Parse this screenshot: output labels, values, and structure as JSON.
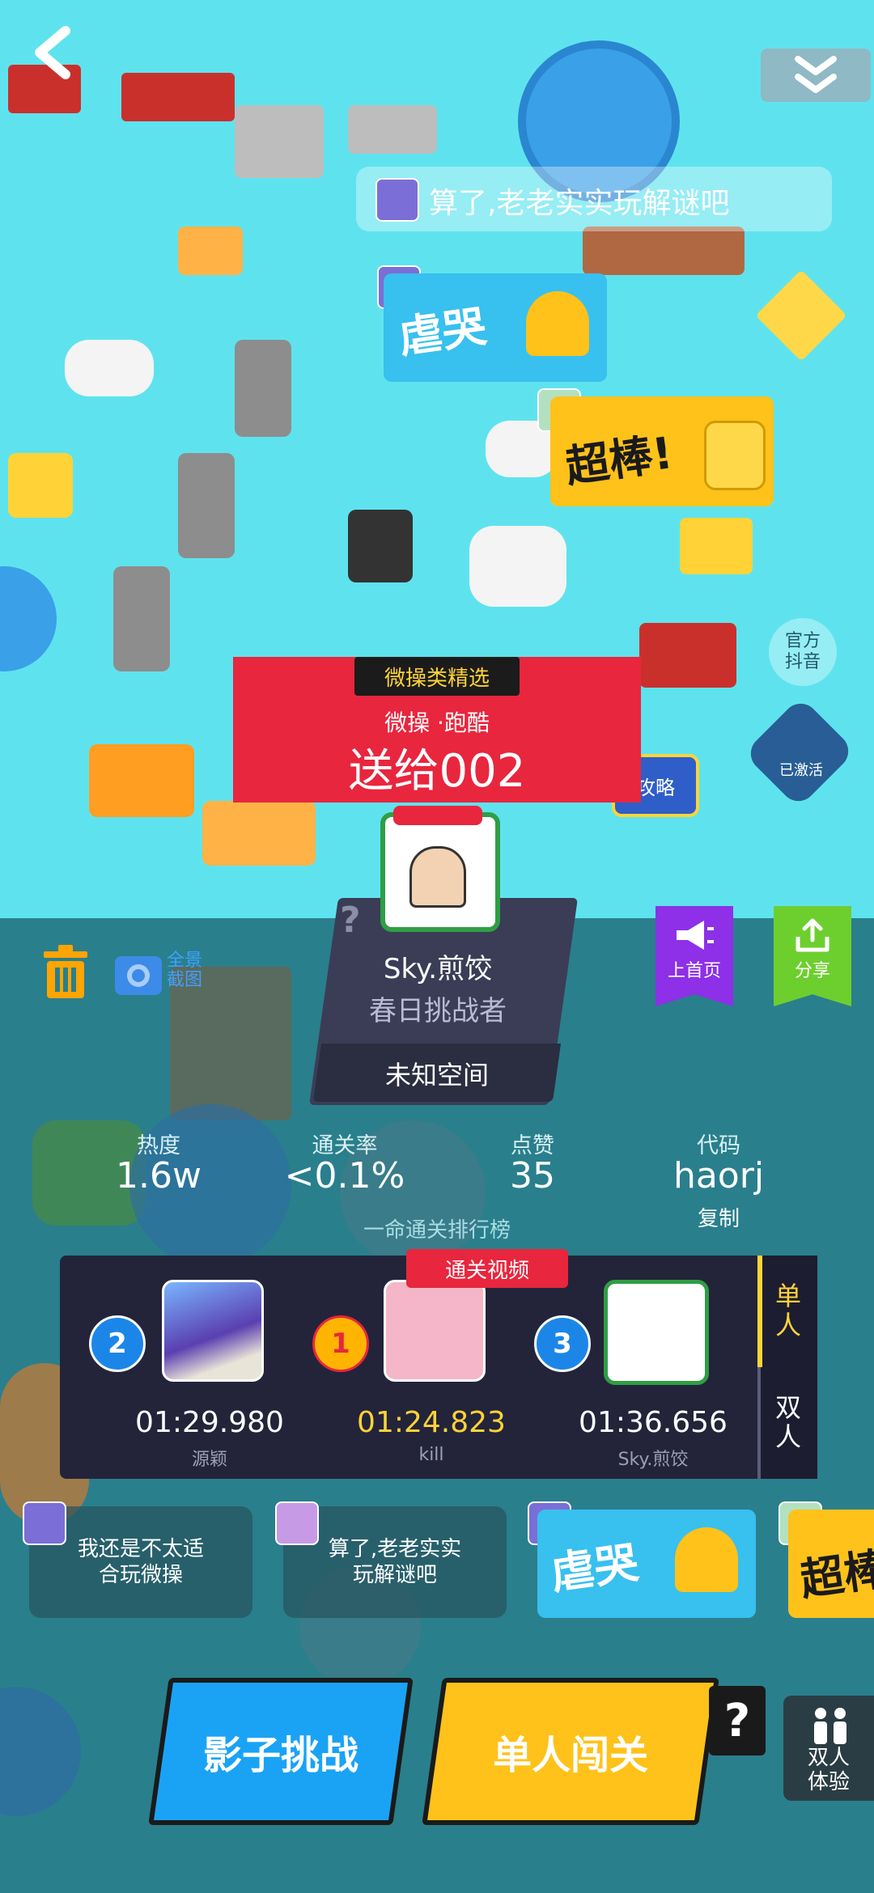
{
  "top_bar": {
    "back_icon": "chevron-left-icon",
    "collapse_icon": "double-chevron-down-icon"
  },
  "bubbles": {
    "top_comment": "算了,老老实实玩解谜吧"
  },
  "stickers": {
    "cry": "虐哭",
    "great": "超棒!"
  },
  "side_labels": {
    "official_douyin": "官方\n抖音",
    "strategy": "攻略",
    "activated": "已激活"
  },
  "level_info": {
    "category_tag": "微操类精选",
    "subtitle": "微操 ·跑酷",
    "title": "送给002",
    "creator_name": "Sky.煎饺",
    "creator_title": "春日挑战者",
    "space": "未知空间",
    "unknown_mark": "?"
  },
  "tools": {
    "trash_icon": "trash-icon",
    "camera_icon": "camera-icon",
    "fullscreen_screenshot": "全景\n截图",
    "homepage": "上首页",
    "share": "分享"
  },
  "stats": {
    "heat_label": "热度",
    "heat_value": "1.6w",
    "pass_rate_label": "通关率",
    "pass_rate_value": "<0.1%",
    "likes_label": "点赞",
    "likes_value": "35",
    "code_label": "代码",
    "code_value": "haorj",
    "copy_label": "复制"
  },
  "leaderboard": {
    "title": "一命通关排行榜",
    "video_tag": "通关视频",
    "tabs": [
      "单\n人",
      "双\n人"
    ],
    "entries": [
      {
        "rank": "2",
        "time": "01:29.980",
        "name": "源颖"
      },
      {
        "rank": "1",
        "time": "01:24.823",
        "name": "kill"
      },
      {
        "rank": "3",
        "time": "01:36.656",
        "name": "Sky.煎饺"
      }
    ]
  },
  "comments": [
    "我还是不太适\n合玩微操",
    "算了,老老实实\n玩解谜吧"
  ],
  "bottom": {
    "shadow_challenge": "影子挑战",
    "single_play": "单人闯关",
    "help": "?",
    "duo_experience": "双人\n体验"
  },
  "colors": {
    "sky": "#5ee3ee",
    "info_red": "#e8263e",
    "gold": "#ffd338",
    "blue_button": "#1aa3f5",
    "yellow_button": "#ffc21a",
    "purple": "#8d30e8",
    "green": "#6dcf2e"
  }
}
